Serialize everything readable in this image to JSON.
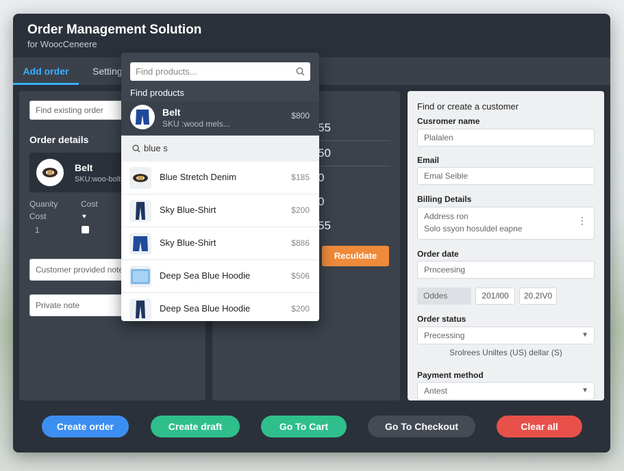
{
  "app": {
    "title": "Order Management Solution",
    "subtitle": "for WoocCeneere"
  },
  "tabs": [
    {
      "label": "Add order"
    },
    {
      "label": "Setting"
    }
  ],
  "left": {
    "find_placeholder": "Find existing order",
    "order_details_label": "Order details",
    "product_name": "Belt",
    "product_sku": "SKU:woo-bolt",
    "col_quantity": "Quanity",
    "col_cost_a": "Cost",
    "col_cost_b": "Cost",
    "quantity_value": "1",
    "customer_note_placeholder": "Customer provided note",
    "private_note_placeholder": "Private note"
  },
  "middle": {
    "totals": [
      "55",
      "50",
      "0",
      "0",
      "55"
    ],
    "recalculate_label": "Reculdate"
  },
  "dropdown": {
    "search_placeholder": "Find products...",
    "heading": "Find products",
    "selected": {
      "name": "Belt",
      "sku": "SKU :wood mels...",
      "price": "$800"
    },
    "filter_text": "blue s",
    "items": [
      {
        "name": "Blue Stretch Denim",
        "price": "$185",
        "icon": "belt-icon"
      },
      {
        "name": "Sky Blue-Shirt",
        "price": "$200",
        "icon": "pants-icon"
      },
      {
        "name": "Sky Blue-Shirt",
        "price": "$886",
        "icon": "shorts-icon"
      },
      {
        "name": "Deep Sea Blue Hoodie",
        "price": "$506",
        "icon": "hoodie-icon"
      },
      {
        "name": "Deep Sea Blue Hoodie",
        "price": "$200",
        "icon": "pants-icon"
      }
    ]
  },
  "customer": {
    "title": "Find or create a customer",
    "name_label": "Cusromer name",
    "name_placeholder": "Plalalen",
    "email_label": "Email",
    "email_placeholder": "Emal Seible",
    "billing_label": "Billing Details",
    "billing_line1": "Address ron",
    "billing_line2": "Solo ssyon hosuldel eapne",
    "order_date_label": "Order date",
    "order_date_value": "Prnceesing",
    "date_field_1": "Oddes",
    "date_field_2": "201/l00",
    "date_field_3": "20.2IV0",
    "status_label": "Order status",
    "status_value": "Precessing",
    "currency_text": "Srolrees Uniltes (US) dellar (S)",
    "payment_label": "Payment method",
    "payment_value": "Antest"
  },
  "footer": {
    "create_order": "Create order",
    "create_draft": "Create draft",
    "go_to_cart": "Go To Cart",
    "go_to_checkout": "Go To Checkout",
    "clear_all": "Clear all"
  },
  "colors": {
    "accent": "#3ab0ff",
    "create_order": "#3c8ff0",
    "create_draft": "#2fbf8c",
    "go_to_cart": "#2fbf8c",
    "go_to_checkout": "#454b55",
    "clear_all": "#e8504a",
    "recalculate": "#ee8a3a"
  }
}
